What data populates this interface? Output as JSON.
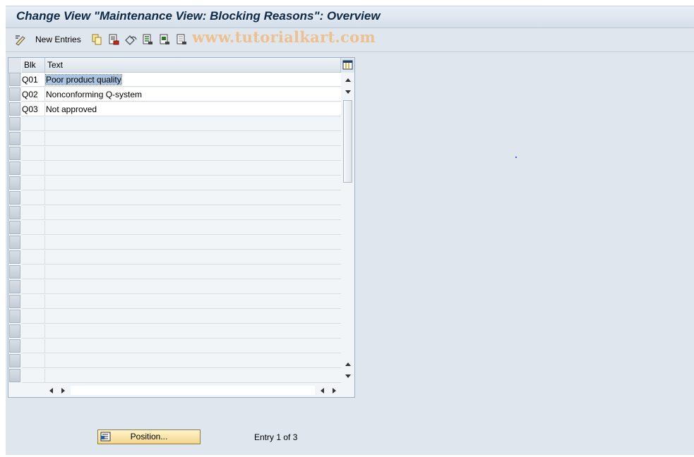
{
  "window": {
    "title": "Change View \"Maintenance View: Blocking Reasons\": Overview"
  },
  "toolbar": {
    "new_entries_label": "New Entries",
    "watermark": "www.tutorialkart.com",
    "icons": [
      "display-change-icon",
      "copy-icon",
      "delete-icon",
      "undo-icon",
      "select-all-icon",
      "select-block-icon",
      "deselect-all-icon"
    ]
  },
  "table": {
    "headers": {
      "blk": "Blk",
      "text": "Text"
    },
    "rows": [
      {
        "blk": "Q01",
        "text": "Poor product quality"
      },
      {
        "blk": "Q02",
        "text": "Nonconforming Q-system"
      },
      {
        "blk": "Q03",
        "text": "Not approved"
      }
    ],
    "empty_rows": 18
  },
  "footer": {
    "position_button_label": "Position...",
    "entry_info": "Entry 1 of 3"
  },
  "colors": {
    "title": "#0e2a46",
    "background": "#dfe6ee",
    "selection": "#a9c3e0",
    "button": "#f3d68d",
    "watermark": "#ecc08f"
  }
}
